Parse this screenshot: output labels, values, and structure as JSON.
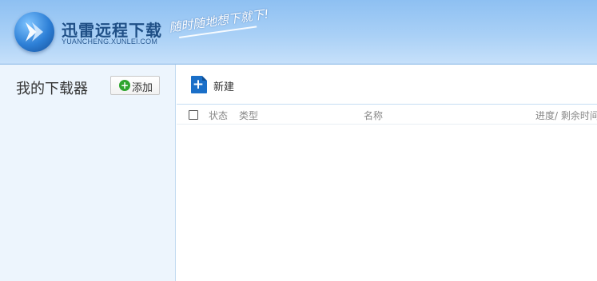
{
  "header": {
    "title": "迅雷远程下载",
    "subtitle": "YUANCHENG.XUNLEI.COM",
    "slogan": "随时随地想下就下!",
    "logo_icon": "xunlei-arrow-logo",
    "accent_color": "#8ec0f2"
  },
  "sidebar": {
    "title": "我的下载器",
    "add_button_label": "添加",
    "add_icon": "plus-circle-icon"
  },
  "toolbar": {
    "new_label": "新建",
    "new_icon": "new-file-plus-icon"
  },
  "columns": {
    "status": "状态",
    "type": "类型",
    "name": "名称",
    "progress": "进度/ 剩余时间"
  }
}
